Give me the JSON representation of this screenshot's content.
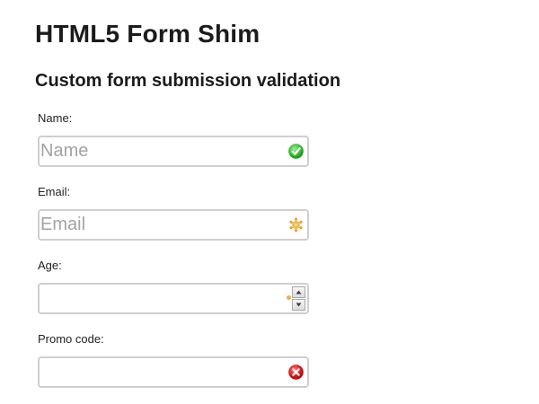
{
  "page": {
    "title": "HTML5 Form Shim",
    "subtitle": "Custom form submission validation"
  },
  "form": {
    "fields": [
      {
        "label": "Name:",
        "placeholder": "Name",
        "value": "",
        "status_icon": "valid-check-icon",
        "status_color": "#3cc43c"
      },
      {
        "label": "Email:",
        "placeholder": "Email",
        "value": "",
        "status_icon": "required-asterisk-icon",
        "status_color": "#e0a030"
      },
      {
        "label": "Age:",
        "placeholder": "",
        "value": "",
        "control": "number-spinner",
        "status_color": "#e9b24c"
      },
      {
        "label": "Promo code:",
        "placeholder": "",
        "value": "",
        "status_icon": "invalid-x-icon",
        "status_color": "#e02020"
      }
    ]
  }
}
